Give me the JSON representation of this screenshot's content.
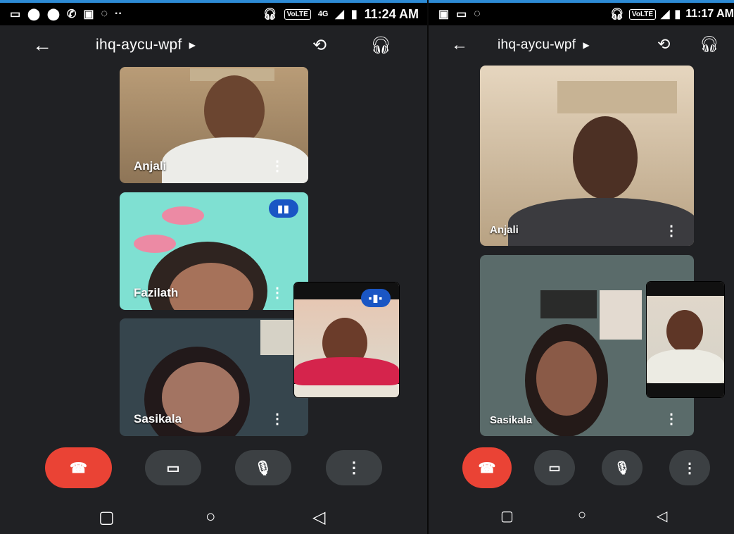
{
  "left": {
    "status": {
      "time": "11:24 AM",
      "volte": "VoLTE",
      "signal": "4G"
    },
    "meeting_code": "ihq-aycu-wpf",
    "participants": [
      "Anjali",
      "Fazilath",
      "Sasikala"
    ]
  },
  "right": {
    "status": {
      "time": "11:17 AM",
      "volte": "VoLTE"
    },
    "meeting_code": "ihq-aycu-wpf",
    "participants": [
      "Anjali",
      "Sasikala"
    ]
  }
}
